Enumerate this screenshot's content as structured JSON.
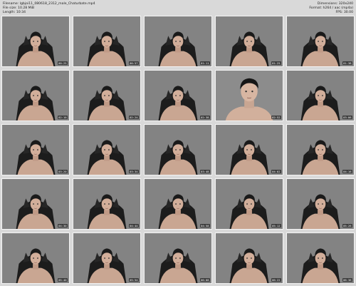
{
  "header": {
    "left": [
      "Filename: lgbjoi11_080618_2312_male_Chaturbate.mp4",
      "File size: 10.28 MiB",
      "Length: 10:34"
    ],
    "right": [
      "Dimensions: 320x240",
      "Format: h264 / aac (mp4a)",
      "FPS: 30.00"
    ]
  },
  "thumbnails": [
    {
      "time": "00:25",
      "shot": "wide"
    },
    {
      "time": "00:57",
      "shot": "wide"
    },
    {
      "time": "01:11",
      "shot": "wide"
    },
    {
      "time": "01:25",
      "shot": "wide"
    },
    {
      "time": "01:38",
      "shot": "wide"
    },
    {
      "time": "02:10",
      "shot": "wide"
    },
    {
      "time": "02:24",
      "shot": "wide"
    },
    {
      "time": "02:38",
      "shot": "wide"
    },
    {
      "time": "02:52",
      "shot": "close"
    },
    {
      "time": "03:06",
      "shot": "wide"
    },
    {
      "time": "03:20",
      "shot": "wide"
    },
    {
      "time": "03:34",
      "shot": "wide"
    },
    {
      "time": "03:48",
      "shot": "wide"
    },
    {
      "time": "04:02",
      "shot": "wide"
    },
    {
      "time": "04:16",
      "shot": "wide"
    },
    {
      "time": "04:30",
      "shot": "wide"
    },
    {
      "time": "04:44",
      "shot": "wide"
    },
    {
      "time": "04:58",
      "shot": "wide"
    },
    {
      "time": "05:12",
      "shot": "wide"
    },
    {
      "time": "05:26",
      "shot": "wide"
    },
    {
      "time": "05:40",
      "shot": "wide"
    },
    {
      "time": "05:54",
      "shot": "wide"
    },
    {
      "time": "06:08",
      "shot": "wide"
    },
    {
      "time": "06:22",
      "shot": "wide"
    },
    {
      "time": "06:36",
      "shot": "wide"
    }
  ]
}
